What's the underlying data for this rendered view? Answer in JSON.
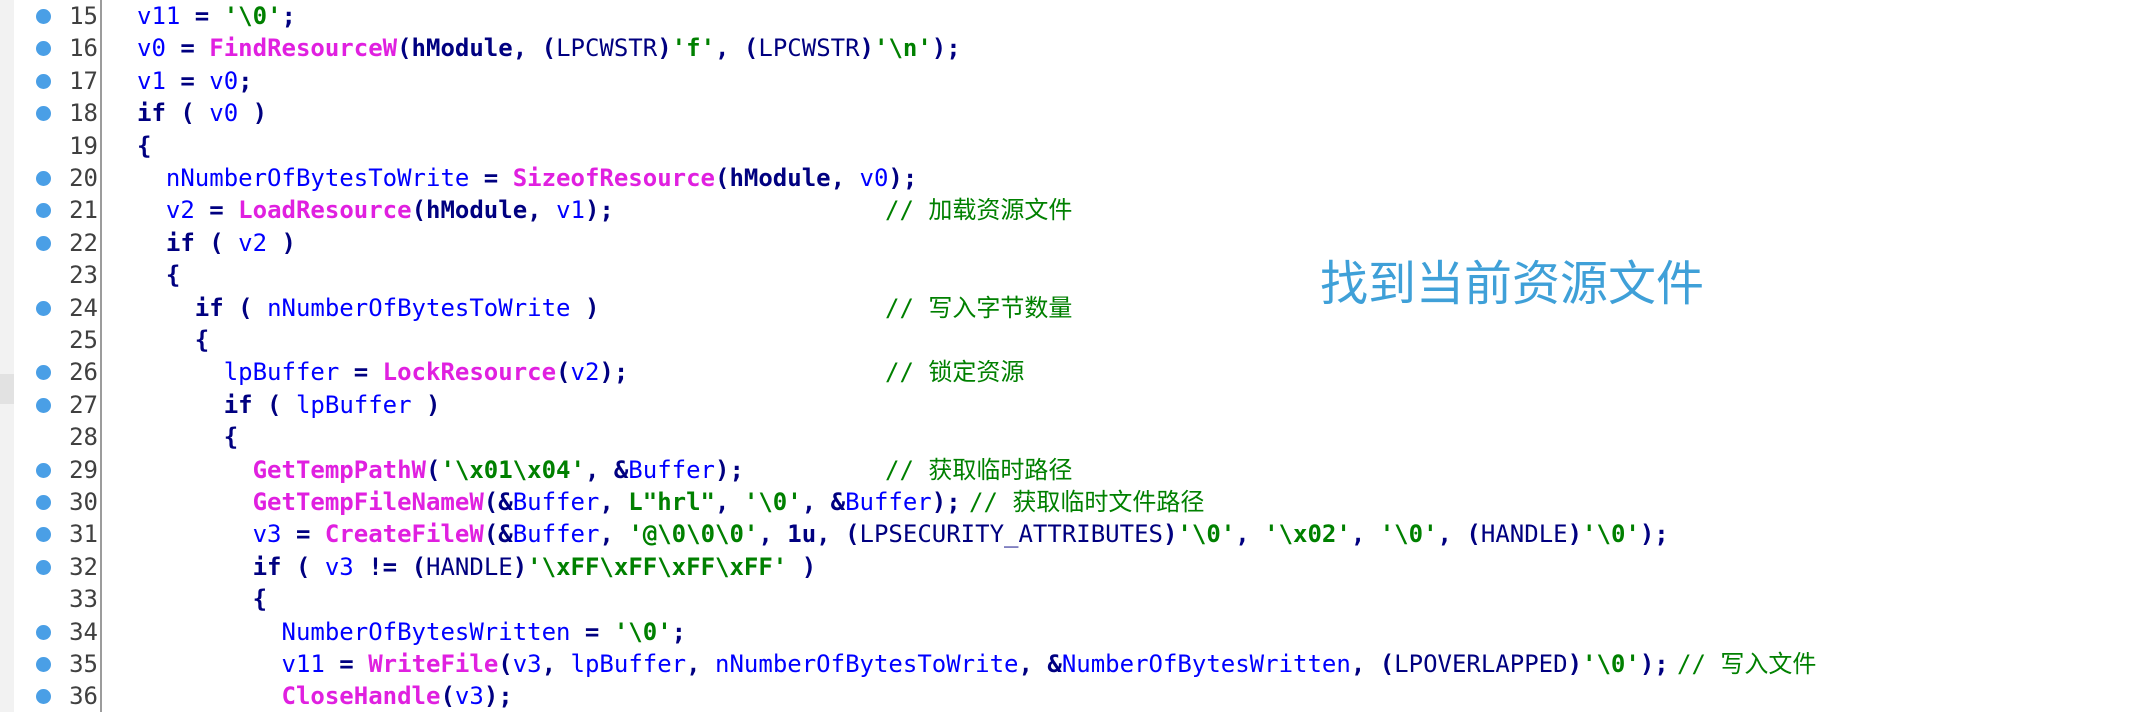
{
  "annotation": "找到当前资源文件",
  "lines": [
    {
      "n": "15",
      "code": [
        [
          "v11",
          "var"
        ],
        [
          " = ",
          ""
        ],
        [
          "'\\0'",
          "str"
        ],
        [
          ";",
          ""
        ]
      ],
      "comment": ""
    },
    {
      "n": "16",
      "code": [
        [
          "v0",
          "var"
        ],
        [
          " = ",
          ""
        ],
        [
          "FindResourceW",
          "func"
        ],
        [
          "(hModule, (",
          ""
        ],
        [
          "LPCWSTR",
          "type"
        ],
        [
          ")",
          ""
        ],
        [
          "'f'",
          "str"
        ],
        [
          ", (",
          ""
        ],
        [
          "LPCWSTR",
          "type"
        ],
        [
          ")",
          ""
        ],
        [
          "'\\n'",
          "str"
        ],
        [
          ");",
          ""
        ]
      ],
      "comment": ""
    },
    {
      "n": "17",
      "code": [
        [
          "v1",
          "var"
        ],
        [
          " = ",
          ""
        ],
        [
          "v0",
          "var"
        ],
        [
          ";",
          ""
        ]
      ],
      "comment": ""
    },
    {
      "n": "18",
      "code": [
        [
          "if",
          "kw"
        ],
        [
          " ( ",
          ""
        ],
        [
          "v0",
          "var"
        ],
        [
          " )",
          ""
        ]
      ],
      "comment": ""
    },
    {
      "n": "19",
      "code": [
        [
          "{",
          ""
        ]
      ],
      "comment": ""
    },
    {
      "n": "20",
      "code": [
        [
          "  ",
          ""
        ],
        [
          "nNumberOfBytesToWrite",
          "var"
        ],
        [
          " = ",
          ""
        ],
        [
          "SizeofResource",
          "func"
        ],
        [
          "(hModule, ",
          ""
        ],
        [
          "v0",
          "var"
        ],
        [
          ");",
          ""
        ]
      ],
      "comment": ""
    },
    {
      "n": "21",
      "code": [
        [
          "  ",
          ""
        ],
        [
          "v2",
          "var"
        ],
        [
          " = ",
          ""
        ],
        [
          "LoadResource",
          "func"
        ],
        [
          "(hModule, ",
          ""
        ],
        [
          "v1",
          "var"
        ],
        [
          ");",
          ""
        ]
      ],
      "comment": "// 加载资源文件"
    },
    {
      "n": "22",
      "code": [
        [
          "  ",
          ""
        ],
        [
          "if",
          "kw"
        ],
        [
          " ( ",
          ""
        ],
        [
          "v2",
          "var"
        ],
        [
          " )",
          ""
        ]
      ],
      "comment": ""
    },
    {
      "n": "23",
      "code": [
        [
          "  {",
          ""
        ]
      ],
      "comment": ""
    },
    {
      "n": "24",
      "code": [
        [
          "    ",
          ""
        ],
        [
          "if",
          "kw"
        ],
        [
          " ( ",
          ""
        ],
        [
          "nNumberOfBytesToWrite",
          "var"
        ],
        [
          " )",
          ""
        ]
      ],
      "comment": "// 写入字节数量"
    },
    {
      "n": "25",
      "code": [
        [
          "    {",
          ""
        ]
      ],
      "comment": ""
    },
    {
      "n": "26",
      "code": [
        [
          "      ",
          ""
        ],
        [
          "lpBuffer",
          "var"
        ],
        [
          " = ",
          ""
        ],
        [
          "LockResource",
          "func"
        ],
        [
          "(",
          ""
        ],
        [
          "v2",
          "var"
        ],
        [
          ");",
          ""
        ]
      ],
      "comment": "// 锁定资源"
    },
    {
      "n": "27",
      "code": [
        [
          "      ",
          ""
        ],
        [
          "if",
          "kw"
        ],
        [
          " ( ",
          ""
        ],
        [
          "lpBuffer",
          "var"
        ],
        [
          " )",
          ""
        ]
      ],
      "comment": ""
    },
    {
      "n": "28",
      "code": [
        [
          "      {",
          ""
        ]
      ],
      "comment": ""
    },
    {
      "n": "29",
      "code": [
        [
          "        ",
          ""
        ],
        [
          "GetTempPathW",
          "func"
        ],
        [
          "(",
          ""
        ],
        [
          "'\\x01\\x04'",
          "str"
        ],
        [
          ", &",
          ""
        ],
        [
          "Buffer",
          "var"
        ],
        [
          ");",
          ""
        ]
      ],
      "comment": "// 获取临时路径"
    },
    {
      "n": "30",
      "code": [
        [
          "        ",
          ""
        ],
        [
          "GetTempFileNameW",
          "func"
        ],
        [
          "(&",
          ""
        ],
        [
          "Buffer",
          "var"
        ],
        [
          ", ",
          ""
        ],
        [
          "L\"hrl\"",
          "str"
        ],
        [
          ", ",
          ""
        ],
        [
          "'\\0'",
          "str"
        ],
        [
          ", &",
          ""
        ],
        [
          "Buffer",
          "var"
        ],
        [
          ");",
          ""
        ]
      ],
      "comment": "// 获取临时文件路径"
    },
    {
      "n": "31",
      "code": [
        [
          "        ",
          ""
        ],
        [
          "v3",
          "var"
        ],
        [
          " = ",
          ""
        ],
        [
          "CreateFileW",
          "func"
        ],
        [
          "(&",
          ""
        ],
        [
          "Buffer",
          "var"
        ],
        [
          ", ",
          ""
        ],
        [
          "'@\\0\\0\\0'",
          "str"
        ],
        [
          ", 1u, (",
          ""
        ],
        [
          "LPSECURITY_ATTRIBUTES",
          "type"
        ],
        [
          ")",
          ""
        ],
        [
          "'\\0'",
          "str"
        ],
        [
          ", ",
          ""
        ],
        [
          "'\\x02'",
          "str"
        ],
        [
          ", ",
          ""
        ],
        [
          "'\\0'",
          "str"
        ],
        [
          ", (",
          ""
        ],
        [
          "HANDLE",
          "type"
        ],
        [
          ")",
          ""
        ],
        [
          "'\\0'",
          "str"
        ],
        [
          ");",
          ""
        ]
      ],
      "comment": ""
    },
    {
      "n": "32",
      "code": [
        [
          "        ",
          ""
        ],
        [
          "if",
          "kw"
        ],
        [
          " ( ",
          ""
        ],
        [
          "v3",
          "var"
        ],
        [
          " != (",
          ""
        ],
        [
          "HANDLE",
          "type"
        ],
        [
          ")",
          ""
        ],
        [
          "'\\xFF\\xFF\\xFF\\xFF'",
          "str"
        ],
        [
          " )",
          ""
        ]
      ],
      "comment": ""
    },
    {
      "n": "33",
      "code": [
        [
          "        {",
          ""
        ]
      ],
      "comment": ""
    },
    {
      "n": "34",
      "code": [
        [
          "          ",
          ""
        ],
        [
          "NumberOfBytesWritten",
          "var"
        ],
        [
          " = ",
          ""
        ],
        [
          "'\\0'",
          "str"
        ],
        [
          ";",
          ""
        ]
      ],
      "comment": ""
    },
    {
      "n": "35",
      "code": [
        [
          "          ",
          ""
        ],
        [
          "v11",
          "var"
        ],
        [
          " = ",
          ""
        ],
        [
          "WriteFile",
          "func"
        ],
        [
          "(",
          ""
        ],
        [
          "v3",
          "var"
        ],
        [
          ", ",
          ""
        ],
        [
          "lpBuffer",
          "var"
        ],
        [
          ", ",
          ""
        ],
        [
          "nNumberOfBytesToWrite",
          "var"
        ],
        [
          ", &",
          ""
        ],
        [
          "NumberOfBytesWritten",
          "var"
        ],
        [
          ", (",
          ""
        ],
        [
          "LPOVERLAPPED",
          "type"
        ],
        [
          ")",
          ""
        ],
        [
          "'\\0'",
          "str"
        ],
        [
          ");",
          ""
        ]
      ],
      "comment": "// 写入文件"
    },
    {
      "n": "36",
      "code": [
        [
          "          ",
          ""
        ],
        [
          "CloseHandle",
          "func"
        ],
        [
          "(",
          ""
        ],
        [
          "v3",
          "var"
        ],
        [
          ");",
          ""
        ]
      ],
      "comment": ""
    }
  ]
}
